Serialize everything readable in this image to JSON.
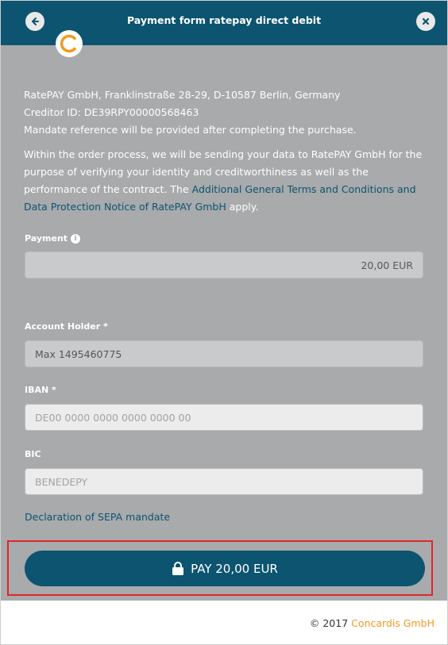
{
  "header": {
    "title": "Payment form ratepay direct debit",
    "back_icon": "arrow-left-icon",
    "close_icon": "close-icon",
    "logo_icon": "concardis-logo-icon"
  },
  "info": {
    "address": "RatePAY GmbH, Franklinstraße 28-29, D-10587 Berlin, Germany",
    "creditor": "Creditor ID: DE39RPY00000568463",
    "mandate_note": "Mandate reference will be provided after completing the purchase.",
    "terms_prefix": "Within the order process, we will be sending your data to RatePAY GmbH for the purpose of verifying your identity and creditworthiness as well as the performance of the contract. The ",
    "terms_link": "Additional General Terms and Conditions and Data Protection Notice of RatePAY GmbH",
    "terms_suffix": " apply."
  },
  "payment": {
    "label": "Payment",
    "amount": "20,00",
    "currency": "EUR"
  },
  "account_holder": {
    "label": "Account Holder *",
    "value": "Max 1495460775"
  },
  "iban": {
    "label": "IBAN *",
    "placeholder": "DE00 0000 0000 0000 0000 00"
  },
  "bic": {
    "label": "BIC",
    "placeholder": "BENEDEPY"
  },
  "sepa_link": "Declaration of SEPA mandate",
  "pay_button": {
    "label": "PAY 20,00 EUR",
    "icon": "lock-icon"
  },
  "footer": {
    "copyright": "© 2017",
    "brand": "Concardis GmbH"
  },
  "colors": {
    "header": "#0c5470",
    "body": "#a8aaab",
    "brand": "#f39a1e",
    "highlight": "#e1252d"
  }
}
